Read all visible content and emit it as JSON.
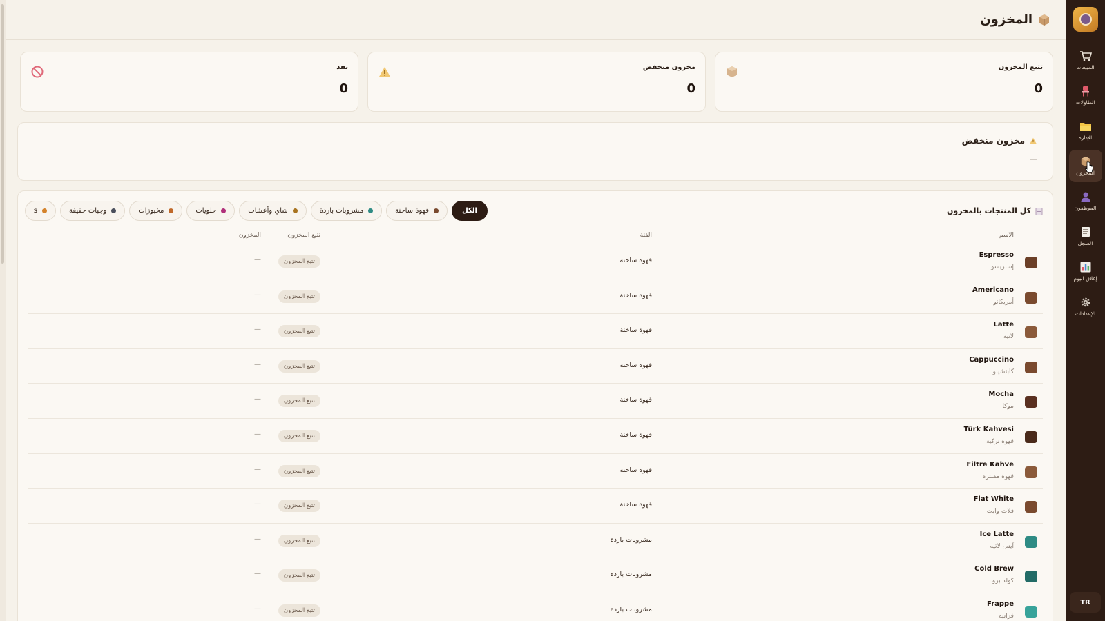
{
  "app": {
    "title": "المخزون",
    "language": "TR"
  },
  "sidebar": {
    "items": [
      {
        "key": "sales",
        "label": "المبيعات",
        "icon": "cart-icon"
      },
      {
        "key": "tables",
        "label": "الطاولات",
        "icon": "chair-icon"
      },
      {
        "key": "management",
        "label": "الإدارة",
        "icon": "folder-icon"
      },
      {
        "key": "inventory",
        "label": "المخزون",
        "icon": "box-icon",
        "active": true
      },
      {
        "key": "employees",
        "label": "الموظفون",
        "icon": "person-icon"
      },
      {
        "key": "log",
        "label": "السجل",
        "icon": "document-icon"
      },
      {
        "key": "close-day",
        "label": "إغلاق اليوم",
        "icon": "chart-icon"
      },
      {
        "key": "settings",
        "label": "الإعدادات",
        "icon": "gear-icon"
      }
    ]
  },
  "stats": [
    {
      "label": "تتبع المخزون",
      "value": "0",
      "icon": "box-icon"
    },
    {
      "label": "مخزون منخفض",
      "value": "0",
      "icon": "warning-icon"
    },
    {
      "label": "نفد",
      "value": "0",
      "icon": "prohibited-icon"
    }
  ],
  "low_stock": {
    "title": "مخزون منخفض",
    "empty": "—"
  },
  "products": {
    "title": "كل المنتجات بالمخزون",
    "filters": [
      {
        "label": "الكل",
        "active": true,
        "color": ""
      },
      {
        "label": "قهوة ساخنة",
        "color": "#7a4a2e"
      },
      {
        "label": "مشروبات باردة",
        "color": "#2e8b84"
      },
      {
        "label": "شاي وأعشاب",
        "color": "#a8731f"
      },
      {
        "label": "حلويات",
        "color": "#b0307a"
      },
      {
        "label": "مخبوزات",
        "color": "#c0692a"
      },
      {
        "label": "وجبات خفيفة",
        "color": "#4a4f5c"
      },
      {
        "label": "s",
        "color": "#d4822a"
      }
    ],
    "columns": {
      "name": "الاسم",
      "category": "الفئة",
      "tracking": "تتبع المخزون",
      "stock": "المخزون"
    },
    "rows": [
      {
        "name": "Espresso",
        "alt": "إسبريسو",
        "category": "قهوة ساخنة",
        "tracking": "تتبع المخزون",
        "stock": "—",
        "color": "#6b3f27"
      },
      {
        "name": "Americano",
        "alt": "أمريكانو",
        "category": "قهوة ساخنة",
        "tracking": "تتبع المخزون",
        "stock": "—",
        "color": "#7a4a2e"
      },
      {
        "name": "Latte",
        "alt": "لاتيه",
        "category": "قهوة ساخنة",
        "tracking": "تتبع المخزون",
        "stock": "—",
        "color": "#8b5a3a"
      },
      {
        "name": "Cappuccino",
        "alt": "كابتشينو",
        "category": "قهوة ساخنة",
        "tracking": "تتبع المخزون",
        "stock": "—",
        "color": "#7a4a2e"
      },
      {
        "name": "Mocha",
        "alt": "موكا",
        "category": "قهوة ساخنة",
        "tracking": "تتبع المخزون",
        "stock": "—",
        "color": "#5a3020"
      },
      {
        "name": "Türk Kahvesi",
        "alt": "قهوة تركية",
        "category": "قهوة ساخنة",
        "tracking": "تتبع المخزون",
        "stock": "—",
        "color": "#4a2a1a"
      },
      {
        "name": "Filtre Kahve",
        "alt": "قهوة مفلترة",
        "category": "قهوة ساخنة",
        "tracking": "تتبع المخزون",
        "stock": "—",
        "color": "#8b5a3a"
      },
      {
        "name": "Flat White",
        "alt": "فلات وايت",
        "category": "قهوة ساخنة",
        "tracking": "تتبع المخزون",
        "stock": "—",
        "color": "#7a4a2e"
      },
      {
        "name": "Ice Latte",
        "alt": "آيس لاتيه",
        "category": "مشروبات باردة",
        "tracking": "تتبع المخزون",
        "stock": "—",
        "color": "#2e8b84"
      },
      {
        "name": "Cold Brew",
        "alt": "كولد برو",
        "category": "مشروبات باردة",
        "tracking": "تتبع المخزون",
        "stock": "—",
        "color": "#226b66"
      },
      {
        "name": "Frappe",
        "alt": "فرابيه",
        "category": "مشروبات باردة",
        "tracking": "تتبع المخزون",
        "stock": "—",
        "color": "#38a39a"
      }
    ]
  }
}
